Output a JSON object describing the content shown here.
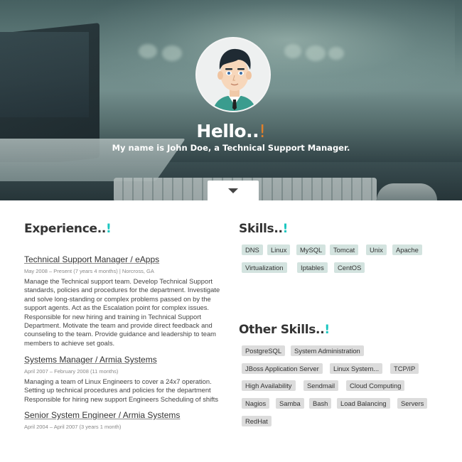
{
  "hero": {
    "greeting": "Hello..",
    "greeting_accent": "!",
    "subtitle": "My name is John Doe, a Technical Support Manager."
  },
  "experience": {
    "title": "Experience..",
    "accent": "!",
    "jobs": [
      {
        "title": "Technical Support Manager / eApps",
        "meta": "May 2008 – Present (7 years 4 months) | Norcross, GA",
        "description": "Manage the Technical support team. Develop Technical Support standards, policies and procedures for the department. Investigate and solve long-standing or complex problems passed on by the support agents. Act as the Escalation point for complex issues. Responsible for new hiring and training in Technical Support Department. Motivate the team and provide direct feedback and counseling to the team. Provide guidance and leadership to team members to achieve set goals."
      },
      {
        "title": "Systems Manager / Armia Systems",
        "meta": "April 2007 – February 2008 (11 months)",
        "description": "Managing a team of Linux Engineers to cover a 24x7 operation. Setting up technical procedures and policies for the department Responsible for hiring new support Engineers Scheduling of shifts"
      },
      {
        "title": "Senior System Engineer / Armia Systems",
        "meta": "April 2004 – April 2007 (3 years 1 month)",
        "description": ""
      }
    ]
  },
  "skills": {
    "title": "Skills..",
    "accent": "!",
    "items": [
      "DNS",
      "Linux",
      "MySQL",
      "Tomcat",
      "Unix",
      "Apache",
      "Virtualization",
      "Iptables",
      "CentOS"
    ]
  },
  "other_skills": {
    "title": "Other Skills..",
    "accent": "!",
    "items": [
      "PostgreSQL",
      "System Administration",
      "JBoss Application Server",
      "Linux System...",
      "TCP/IP",
      "High Availability",
      "Sendmail",
      "Cloud Computing",
      "Nagios",
      "Samba",
      "Bash",
      "Load Balancing",
      "Servers",
      "RedHat"
    ]
  },
  "colors": {
    "accent": "#1bc6c0",
    "greeting_accent": "#e07f2b",
    "skill_tag": "#d3e3df",
    "other_skill_tag": "#dcdcdc"
  },
  "icons": {
    "scroll": "chevron-down-icon",
    "avatar": "avatar-illustration"
  }
}
